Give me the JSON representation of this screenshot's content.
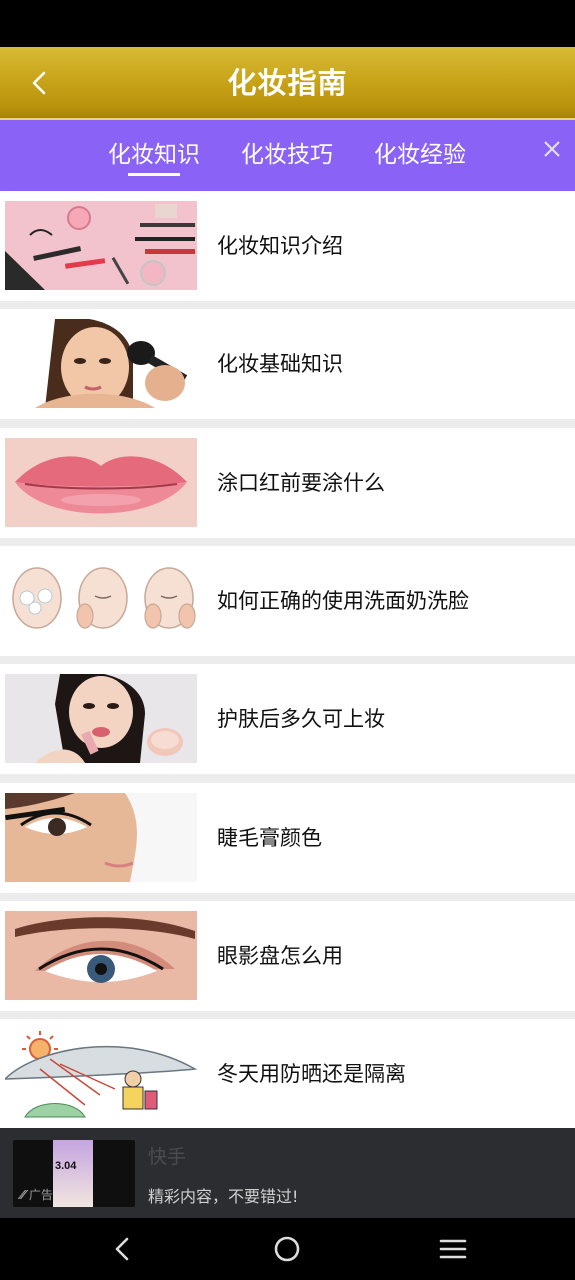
{
  "header": {
    "title": "化妆指南",
    "back_icon": "chevron-left-icon"
  },
  "tabs": [
    {
      "label": "化妆知识",
      "active": true
    },
    {
      "label": "化妆技巧",
      "active": false
    },
    {
      "label": "化妆经验",
      "active": false
    }
  ],
  "items": [
    {
      "label": "化妆知识介绍",
      "image": "cosmetics-flatlay"
    },
    {
      "label": "化妆基础知识",
      "image": "woman-applying-blush"
    },
    {
      "label": "涂口红前要涂什么",
      "image": "lips-closeup"
    },
    {
      "label": "如何正确的使用洗面奶洗脸",
      "image": "face-washing-illustration"
    },
    {
      "label": "护肤后多久可上妆",
      "image": "woman-with-lip-balm"
    },
    {
      "label": "睫毛膏颜色",
      "image": "mascara-eye"
    },
    {
      "label": "眼影盘怎么用",
      "image": "eyeshadow-eye"
    },
    {
      "label": "冬天用防晒还是隔离",
      "image": "sunscreen-cartoon"
    }
  ],
  "ad": {
    "title": "快手",
    "description": "精彩内容，不要错过!",
    "badge": "广告",
    "thumb_text": "3.04"
  },
  "nav": {
    "back": "back-icon",
    "home": "home-icon",
    "menu": "menu-icon"
  },
  "colors": {
    "header": "#c9a51a",
    "tabs": "#8a63f6",
    "ad_bg": "#2b2d31"
  }
}
